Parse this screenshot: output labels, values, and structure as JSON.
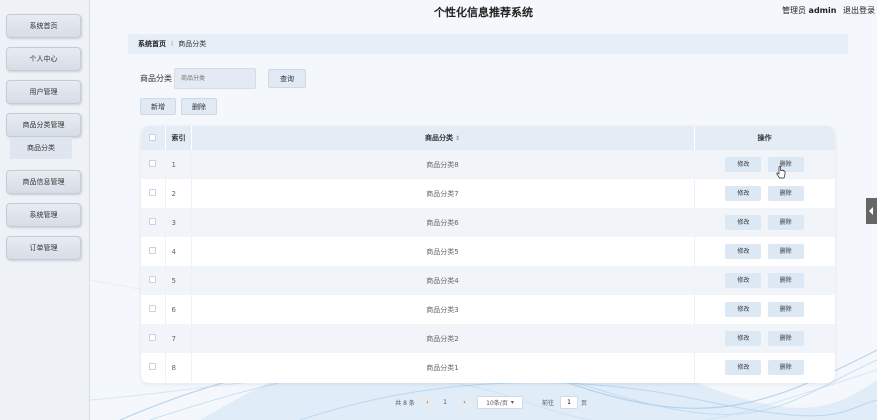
{
  "header": {
    "title": "个性化信息推荐系统",
    "admin_label": "管理员",
    "admin_name": "admin",
    "logout": "退出登录"
  },
  "sidebar": {
    "items": [
      {
        "label": "系统首页"
      },
      {
        "label": "个人中心"
      },
      {
        "label": "用户管理"
      },
      {
        "label": "商品分类管理"
      },
      {
        "label": "商品信息管理"
      },
      {
        "label": "系统管理"
      },
      {
        "label": "订单管理"
      }
    ],
    "sub_item": "商品分类"
  },
  "breadcrumb": {
    "home": "系统首页",
    "current": "商品分类"
  },
  "search": {
    "label": "商品分类",
    "placeholder": "商品分类",
    "button": "查询"
  },
  "actions": {
    "add": "新增",
    "delete": "删除"
  },
  "table": {
    "headers": {
      "index": "索引",
      "name": "商品分类",
      "actions": "操作"
    },
    "edit_label": "修改",
    "delete_label": "删除",
    "rows": [
      {
        "index": "1",
        "name": "商品分类8"
      },
      {
        "index": "2",
        "name": "商品分类7"
      },
      {
        "index": "3",
        "name": "商品分类6"
      },
      {
        "index": "4",
        "name": "商品分类5"
      },
      {
        "index": "5",
        "name": "商品分类4"
      },
      {
        "index": "6",
        "name": "商品分类3"
      },
      {
        "index": "7",
        "name": "商品分类2"
      },
      {
        "index": "8",
        "name": "商品分类1"
      }
    ]
  },
  "pagination": {
    "total": "共 8 条",
    "current_page": "1",
    "page_size": "10条/页",
    "goto_label": "前往",
    "goto_value": "1",
    "page_unit": "页"
  },
  "colors": {
    "accent": "#e1e9f4",
    "header_bg": "#e4ecf6",
    "sidebar_bg": "#eef2f7"
  }
}
